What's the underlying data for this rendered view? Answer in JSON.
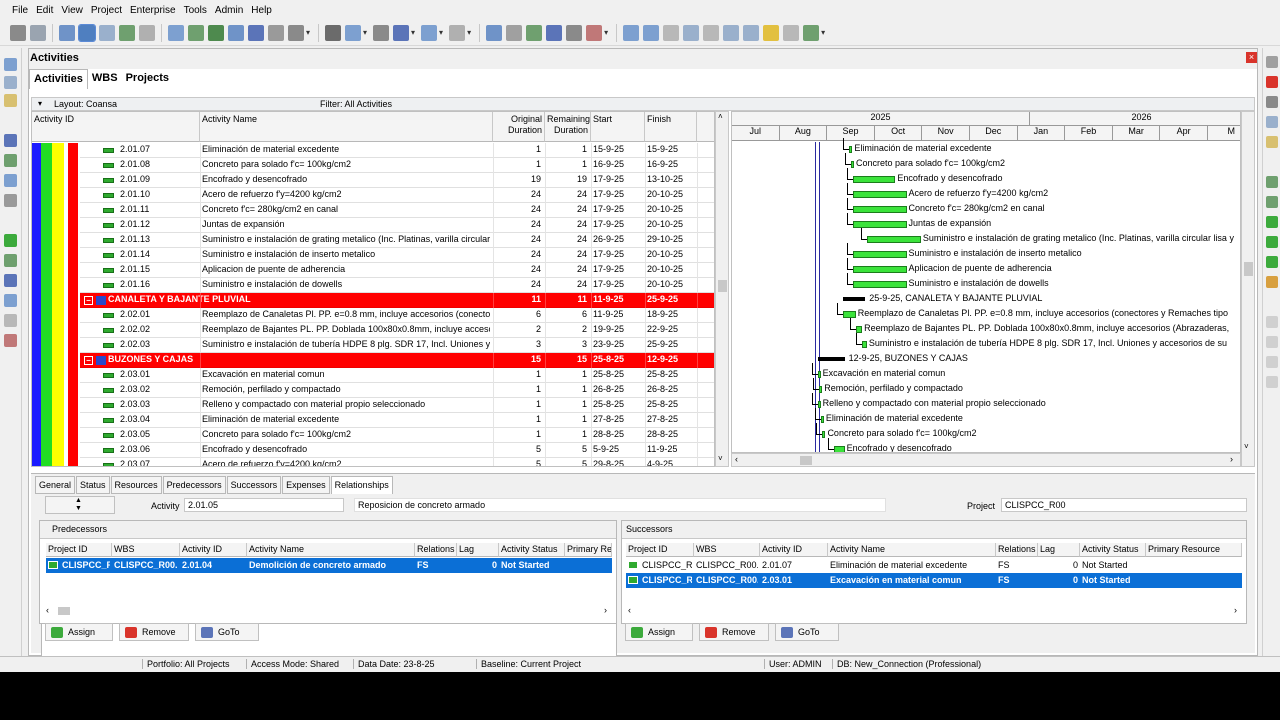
{
  "menu": [
    "File",
    "Edit",
    "View",
    "Project",
    "Enterprise",
    "Tools",
    "Admin",
    "Help"
  ],
  "window": {
    "title": "Activities",
    "close_glyph": "×",
    "tabs": [
      "Activities",
      "WBS",
      "Projects"
    ]
  },
  "layout_bar": {
    "layout": "Layout: Coansa",
    "filter": "Filter: All Activities"
  },
  "grid": {
    "columns": {
      "activity_id": "Activity ID",
      "activity_name": "Activity Name",
      "orig_1": "Original",
      "orig_2": "Duration",
      "rem_1": "Remaining",
      "rem_2": "Duration",
      "start": "Start",
      "finish": "Finish"
    },
    "group_icon": "−",
    "rows": [
      {
        "type": "act",
        "id": "2.01.07",
        "name": "Eliminación de material excedente",
        "od": "1",
        "rd": "1",
        "start": "15-9-25",
        "finish": "15-9-25"
      },
      {
        "type": "act",
        "id": "2.01.08",
        "name": "Concreto para solado f'c= 100kg/cm2",
        "od": "1",
        "rd": "1",
        "start": "16-9-25",
        "finish": "16-9-25"
      },
      {
        "type": "act",
        "id": "2.01.09",
        "name": "Encofrado y desencofrado",
        "od": "19",
        "rd": "19",
        "start": "17-9-25",
        "finish": "13-10-25"
      },
      {
        "type": "act",
        "id": "2.01.10",
        "name": "Acero de refuerzo f'y=4200 kg/cm2",
        "od": "24",
        "rd": "24",
        "start": "17-9-25",
        "finish": "20-10-25"
      },
      {
        "type": "act",
        "id": "2.01.11",
        "name": "Concreto f'c= 280kg/cm2 en canal",
        "od": "24",
        "rd": "24",
        "start": "17-9-25",
        "finish": "20-10-25"
      },
      {
        "type": "act",
        "id": "2.01.12",
        "name": "Juntas de expansión",
        "od": "24",
        "rd": "24",
        "start": "17-9-25",
        "finish": "20-10-25"
      },
      {
        "type": "act",
        "id": "2.01.13",
        "name": "Suministro e instalación de grating metalico (Inc. Platinas, varilla circular li",
        "od": "24",
        "rd": "24",
        "start": "26-9-25",
        "finish": "29-10-25"
      },
      {
        "type": "act",
        "id": "2.01.14",
        "name": "Suministro e instalación de inserto metalico",
        "od": "24",
        "rd": "24",
        "start": "17-9-25",
        "finish": "20-10-25"
      },
      {
        "type": "act",
        "id": "2.01.15",
        "name": "Aplicacion de puente de adherencia",
        "od": "24",
        "rd": "24",
        "start": "17-9-25",
        "finish": "20-10-25"
      },
      {
        "type": "act",
        "id": "2.01.16",
        "name": "Suministro e instalación de dowells",
        "od": "24",
        "rd": "24",
        "start": "17-9-25",
        "finish": "20-10-25"
      },
      {
        "type": "grp",
        "id": "",
        "name": "CANALETA Y BAJANTE PLUVIAL",
        "od": "11",
        "rd": "11",
        "start": "11-9-25",
        "finish": "25-9-25"
      },
      {
        "type": "act",
        "id": "2.02.01",
        "name": "Reemplazo de Canaletas Pl. PP. e=0.8 mm, incluye accesorios (conector",
        "od": "6",
        "rd": "6",
        "start": "11-9-25",
        "finish": "18-9-25"
      },
      {
        "type": "act",
        "id": "2.02.02",
        "name": "Reemplazo de Bajantes PL. PP. Doblada 100x80x0.8mm, incluye accesc",
        "od": "2",
        "rd": "2",
        "start": "19-9-25",
        "finish": "22-9-25"
      },
      {
        "type": "act",
        "id": "2.02.03",
        "name": "Suministro e instalación de tubería HDPE 8 plg. SDR 17, Incl. Uniones y",
        "od": "3",
        "rd": "3",
        "start": "23-9-25",
        "finish": "25-9-25"
      },
      {
        "type": "grp",
        "id": "",
        "name": "BUZONES Y CAJAS",
        "od": "15",
        "rd": "15",
        "start": "25-8-25",
        "finish": "12-9-25"
      },
      {
        "type": "act",
        "id": "2.03.01",
        "name": "Excavación en material comun",
        "od": "1",
        "rd": "1",
        "start": "25-8-25",
        "finish": "25-8-25"
      },
      {
        "type": "act",
        "id": "2.03.02",
        "name": "Remoción, perfilado y compactado",
        "od": "1",
        "rd": "1",
        "start": "26-8-25",
        "finish": "26-8-25"
      },
      {
        "type": "act",
        "id": "2.03.03",
        "name": "Relleno y compactado con material propio seleccionado",
        "od": "1",
        "rd": "1",
        "start": "25-8-25",
        "finish": "25-8-25"
      },
      {
        "type": "act",
        "id": "2.03.04",
        "name": "Eliminación de material excedente",
        "od": "1",
        "rd": "1",
        "start": "27-8-25",
        "finish": "27-8-25"
      },
      {
        "type": "act",
        "id": "2.03.05",
        "name": "Concreto para solado f'c= 100kg/cm2",
        "od": "1",
        "rd": "1",
        "start": "28-8-25",
        "finish": "28-8-25"
      },
      {
        "type": "act",
        "id": "2.03.06",
        "name": "Encofrado y desencofrado",
        "od": "5",
        "rd": "5",
        "start": "5-9-25",
        "finish": "11-9-25"
      },
      {
        "type": "act",
        "id": "2.03.07",
        "name": "Acero de refuerzo f'y=4200 kg/cm2",
        "od": "5",
        "rd": "5",
        "start": "29-8-25",
        "finish": "4-9-25"
      }
    ]
  },
  "gantt": {
    "years": [
      "2025",
      "2026"
    ],
    "months": [
      "Jul",
      "Aug",
      "Sep",
      "Oct",
      "Nov",
      "Dec",
      "Jan",
      "Feb",
      "Mar",
      "Apr",
      "M"
    ],
    "labels": {
      "r0": "Eliminación de material excedente",
      "r1": "Concreto para solado f'c= 100kg/cm2",
      "r2": "Encofrado y desencofrado",
      "r3": "Acero de refuerzo f'y=4200 kg/cm2",
      "r4": "Concreto f'c= 280kg/cm2 en canal",
      "r5": "Juntas de expansión",
      "r6": "Suministro e instalación de grating metalico (Inc. Platinas, varilla circular lisa y",
      "r7": "Suministro e instalación de inserto metalico",
      "r8": "Aplicacion de puente de adherencia",
      "r9": "Suministro e instalación de dowells",
      "r10": "25-9-25, CANALETA Y BAJANTE PLUVIAL",
      "r11": "Reemplazo de Canaletas Pl. PP. e=0.8 mm, incluye accesorios (conectores y Remaches tipo",
      "r12": "Reemplazo de Bajantes PL. PP. Doblada 100x80x0.8mm, incluye accesorios (Abrazaderas,",
      "r13": "Suministro e instalación de tubería HDPE 8 plg. SDR 17, Incl. Uniones y accesorios de su",
      "r14": "12-9-25, BUZONES Y CAJAS",
      "r15": "Excavación en material comun",
      "r16": "Remoción, perfilado y compactado",
      "r17": "Relleno y compactado con material propio seleccionado",
      "r18": "Eliminación de material excedente",
      "r19": "Concreto para solado f'c= 100kg/cm2",
      "r20": "Encofrado y desencofrado"
    }
  },
  "detail": {
    "tabs": [
      "General",
      "Status",
      "Resources",
      "Predecessors",
      "Successors",
      "Expenses",
      "Relationships"
    ],
    "activity_label": "Activity",
    "activity_id": "2.01.05",
    "activity_name": "Reposicion de concreto armado",
    "project_label": "Project",
    "project_value": "CLISPCC_R00",
    "predecessors": {
      "title": "Predecessors",
      "columns": [
        "Project ID",
        "WBS",
        "Activity ID",
        "Activity Name",
        "Relations",
        "Lag",
        "Activity Status",
        "Primary Re"
      ],
      "rows": [
        {
          "project": "CLISPCC_R",
          "wbs": "CLISPCC_R00.",
          "id": "2.01.04",
          "name": "Demolición de concreto armado",
          "rel": "FS",
          "lag": "0",
          "status": "Not Started",
          "res": ""
        }
      ]
    },
    "successors": {
      "title": "Successors",
      "columns": [
        "Project ID",
        "WBS",
        "Activity ID",
        "Activity Name",
        "Relations",
        "Lag",
        "Activity Status",
        "Primary Resource"
      ],
      "rows": [
        {
          "project": "CLISPCC_R",
          "wbs": "CLISPCC_R00.",
          "id": "2.01.07",
          "name": "Eliminación de material excedente",
          "rel": "FS",
          "lag": "0",
          "status": "Not Started",
          "res": ""
        },
        {
          "project": "CLISPCC_R",
          "wbs": "CLISPCC_R00.",
          "id": "2.03.01",
          "name": "Excavación en material comun",
          "rel": "FS",
          "lag": "0",
          "status": "Not Started",
          "res": ""
        }
      ]
    },
    "buttons": {
      "assign": "Assign",
      "remove": "Remove",
      "goto": "GoTo"
    }
  },
  "status_bar": {
    "portfolio": "Portfolio: All Projects",
    "access": "Access Mode: Shared",
    "data_date": "Data Date: 23-8-25",
    "baseline": "Baseline: Current Project",
    "user": "User: ADMIN",
    "db": "DB: New_Connection (Professional)"
  },
  "colors": {
    "group_row": "#ff0000",
    "selection": "#0b6fd6",
    "gantt_bar": "#3be33b",
    "band_blue": "#1a1aff",
    "band_green": "#22dd22",
    "band_yellow": "#ffff00",
    "band_red": "#ff0000"
  }
}
